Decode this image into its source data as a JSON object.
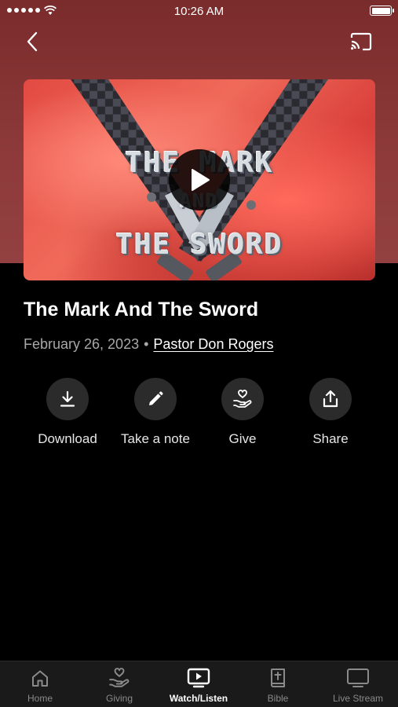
{
  "status_bar": {
    "time": "10:26 AM",
    "signal_icon": "signal-dots-icon",
    "wifi_icon": "wifi-icon",
    "battery_icon": "battery-icon"
  },
  "nav": {
    "back_icon": "chevron-left-icon",
    "cast_icon": "cast-icon"
  },
  "thumbnail": {
    "title_line1": "THE MARK",
    "title_line2": "AND",
    "title_line3": "THE SWORD",
    "play_icon": "play-icon"
  },
  "sermon": {
    "title": "The Mark And The Sword",
    "date": "February 26, 2023",
    "separator": "•",
    "speaker": "Pastor Don Rogers"
  },
  "actions": [
    {
      "label": "Download",
      "icon": "download-icon"
    },
    {
      "label": "Take a note",
      "icon": "pencil-icon"
    },
    {
      "label": "Give",
      "icon": "giving-hand-heart-icon"
    },
    {
      "label": "Share",
      "icon": "share-upload-icon"
    }
  ],
  "tabs": [
    {
      "label": "Home",
      "icon": "home-icon",
      "active": false
    },
    {
      "label": "Giving",
      "icon": "giving-hand-heart-icon",
      "active": false
    },
    {
      "label": "Watch/Listen",
      "icon": "tv-play-icon",
      "active": true
    },
    {
      "label": "Bible",
      "icon": "bible-icon",
      "active": false
    },
    {
      "label": "Live Stream",
      "icon": "monitor-icon",
      "active": false
    }
  ],
  "colors": {
    "header_gradient_top": "#7a2b2b",
    "header_gradient_bottom": "#934040",
    "background": "#000000",
    "tab_bar": "#1a1a1a",
    "action_circle": "#2b2b2b",
    "muted_text": "#a8a8a8"
  }
}
